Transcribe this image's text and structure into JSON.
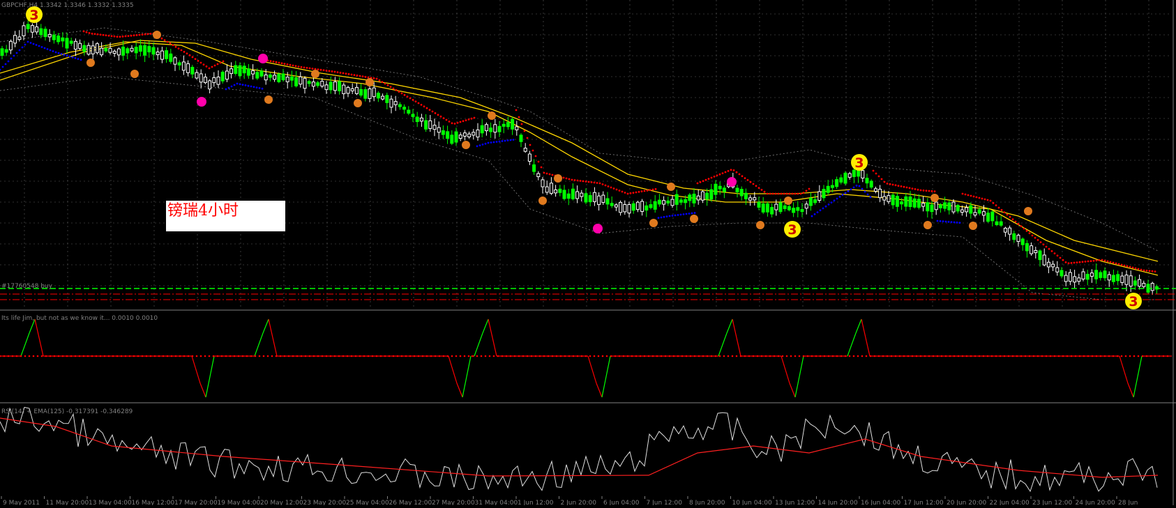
{
  "main_window": {
    "info_line": "GBPCHF,H4  1.3342 1.3346 1.3332 1.3335",
    "order_label": "#17760548 buy",
    "annotation": "镑瑞4小时",
    "wave_badge": "3"
  },
  "indicator_1": {
    "caption": "Its life Jim, but not as we know it...  0.0010 0.0010",
    "colors": {
      "up": "#00ff00",
      "down": "#ff0000"
    }
  },
  "indicator_2": {
    "caption": "RSI(14) + EMA(125) -0.317391 -0.346289",
    "colors": {
      "line": "#e0e0e0",
      "signal": "#ff2020"
    }
  },
  "time_axis": {
    "labels": [
      "9 May 2011",
      "11 May 20:00",
      "13 May 04:00",
      "16 May 12:00",
      "17 May 20:00",
      "19 May 04:00",
      "20 May 12:00",
      "23 May 20:00",
      "25 May 04:00",
      "26 May 12:00",
      "27 May 20:00",
      "31 May 04:00",
      "1 Jun 12:00",
      "2 Jun 20:00",
      "6 Jun 04:00",
      "7 Jun 12:00",
      "8 Jun 20:00",
      "10 Jun 04:00",
      "13 Jun 12:00",
      "14 Jun 20:00",
      "16 Jun 04:00",
      "17 Jun 12:00",
      "20 Jun 20:00",
      "22 Jun 04:00",
      "23 Jun 12:00",
      "24 Jun 20:00",
      "28 Jun"
    ]
  },
  "colors": {
    "background": "#000000",
    "grid": "#606060",
    "bull_candle": "#00ff00",
    "bear_candle": "#ffffff",
    "ma_yellow": "#ffd700",
    "trail_red": "#ff0000",
    "trail_blue": "#0000ff",
    "fractal_orange": "#e07a1e",
    "fractal_magenta": "#ff00aa",
    "order_green": "#00ff00",
    "order_red": "#ff0000"
  }
}
